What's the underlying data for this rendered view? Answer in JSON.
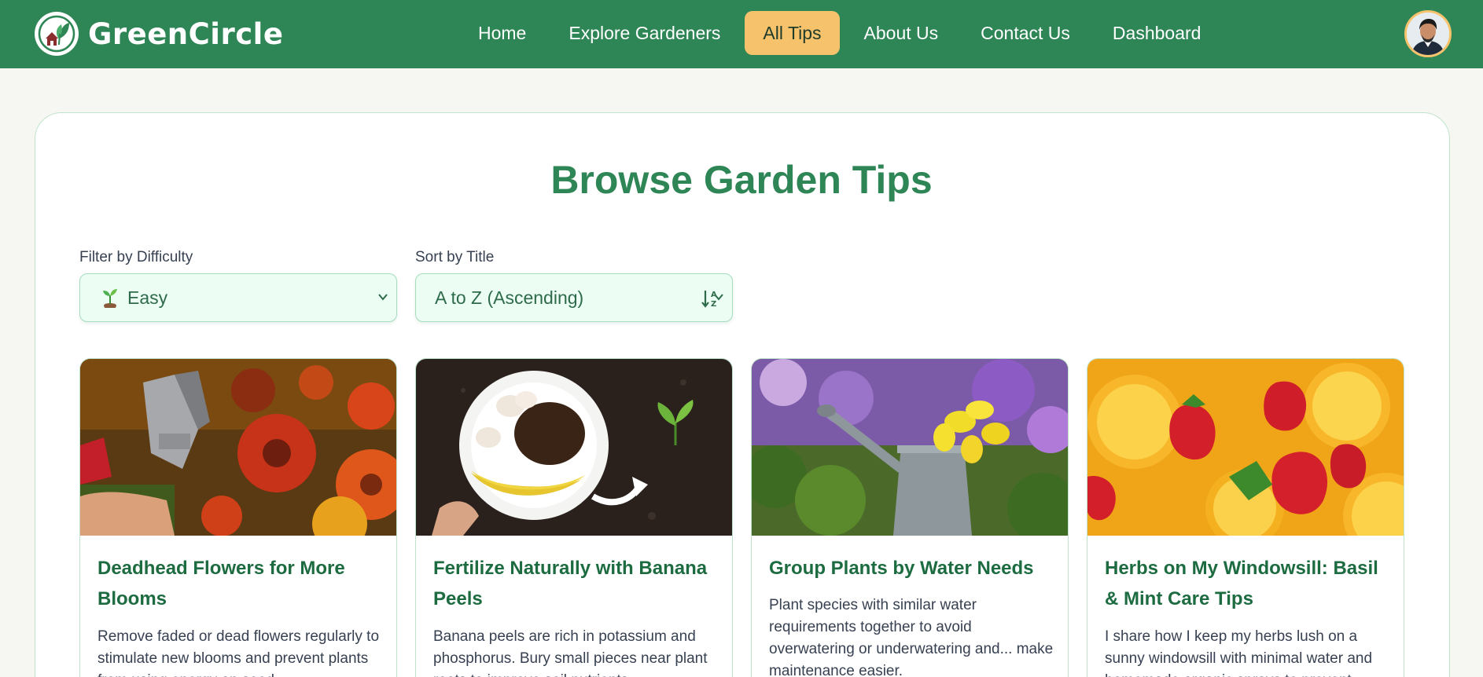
{
  "brand": {
    "name": "GreenCircle"
  },
  "nav": {
    "items": [
      {
        "label": "Home",
        "active": false
      },
      {
        "label": "Explore Gardeners",
        "active": false
      },
      {
        "label": "All Tips",
        "active": true
      },
      {
        "label": "About Us",
        "active": false
      },
      {
        "label": "Contact Us",
        "active": false
      },
      {
        "label": "Dashboard",
        "active": false
      }
    ]
  },
  "page": {
    "title": "Browse Garden Tips"
  },
  "filters": {
    "difficulty": {
      "label": "Filter by Difficulty",
      "value": "Easy",
      "icon": "seedling-icon"
    },
    "sort": {
      "label": "Sort by Title",
      "value": "A to Z (Ascending)",
      "icon": "sort-alpha-icon"
    }
  },
  "tips": [
    {
      "title": "Deadhead Flowers for More Blooms",
      "description": "Remove faded or dead flowers regularly to stimulate new blooms and prevent plants from using energy on seed..."
    },
    {
      "title": "Fertilize Naturally with Banana Peels",
      "description": "Banana peels are rich in potassium and phosphorus. Bury small pieces near plant roots to improve soil nutrients..."
    },
    {
      "title": "Group Plants by Water Needs",
      "description": "Plant species with similar water requirements together to avoid overwatering or underwatering and... make maintenance easier."
    },
    {
      "title": "Herbs on My Windowsill: Basil & Mint Care Tips",
      "description": "I share how I keep my herbs lush on a sunny windowsill with minimal water and homemade organic sprays to prevent..."
    }
  ],
  "colors": {
    "nav_bg": "#2e8555",
    "active_nav": "#f6c36c",
    "title_green": "#2e8555",
    "card_title": "#1d6b41",
    "select_bg": "#ecfdf3"
  }
}
